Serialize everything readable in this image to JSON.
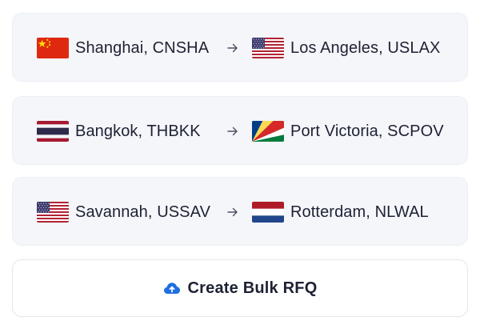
{
  "routes": [
    {
      "origin": {
        "name": "Shanghai, CNSHA",
        "flag_icon": "flag-china-icon"
      },
      "destination": {
        "name": "Los Angeles, USLAX",
        "flag_icon": "flag-usa-icon"
      },
      "arrow_icon": "arrow-right-icon"
    },
    {
      "origin": {
        "name": "Bangkok, THBKK",
        "flag_icon": "flag-thailand-icon"
      },
      "destination": {
        "name": "Port Victoria, SCPOV",
        "flag_icon": "flag-seychelles-icon"
      },
      "arrow_icon": "arrow-right-icon"
    },
    {
      "origin": {
        "name": "Savannah, USSAV",
        "flag_icon": "flag-usa-icon"
      },
      "destination": {
        "name": "Rotterdam, NLWAL",
        "flag_icon": "flag-netherlands-icon"
      },
      "arrow_icon": "arrow-right-icon"
    }
  ],
  "bulk_button": {
    "label": "Create Bulk RFQ",
    "icon": "cloud-upload-icon",
    "icon_color": "#1f6fe0"
  },
  "colors": {
    "card_background": "#f4f6fa",
    "text": "#1e2133"
  }
}
